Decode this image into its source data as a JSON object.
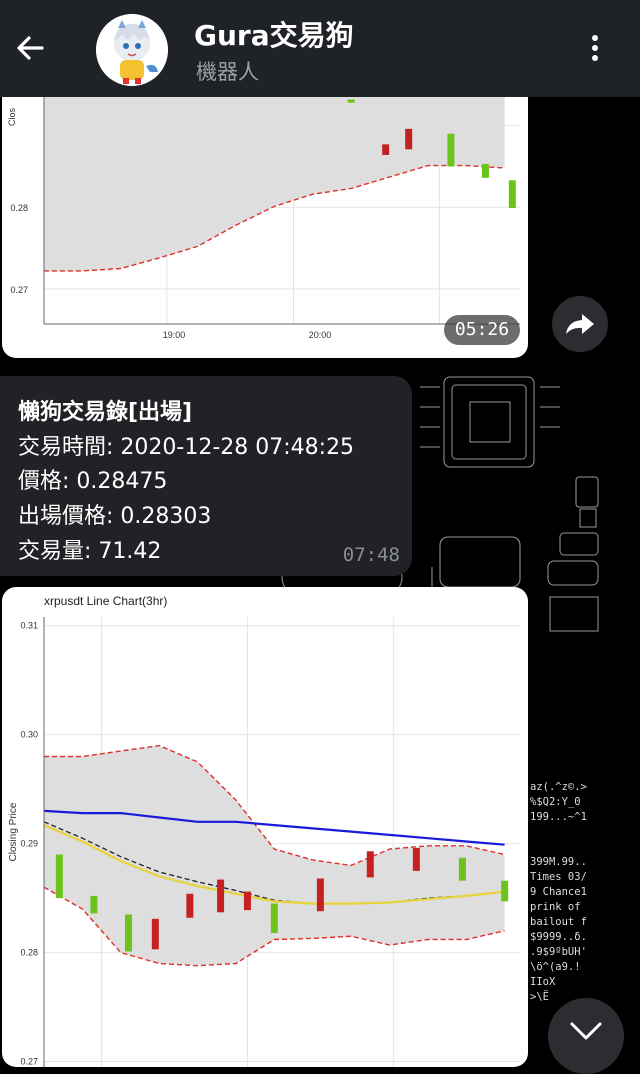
{
  "header": {
    "title": "Gura交易狗",
    "subtitle": "機器人"
  },
  "top_chart": {
    "timestamp": "05:26",
    "chart_data": {
      "type": "line",
      "y_ticks": [
        "0.28",
        "0.27"
      ],
      "x_ticks": [
        "19:00",
        "20:00"
      ],
      "ylabel": "Clos",
      "ylim": [
        0.2657,
        0.2935
      ],
      "x": [
        0,
        1,
        2,
        3,
        4,
        5,
        6,
        7,
        8,
        9,
        10,
        11,
        12
      ],
      "lower_band": [
        0.2722,
        0.2722,
        0.2725,
        0.2738,
        0.2752,
        0.2778,
        0.2801,
        0.2816,
        0.2823,
        0.2837,
        0.2851,
        0.2851,
        0.2848
      ],
      "candles": [
        {
          "x": 8.0,
          "open": 0.2932,
          "close": 0.2928,
          "color": "green"
        },
        {
          "x": 8.9,
          "open": 0.2877,
          "close": 0.2864,
          "color": "red"
        },
        {
          "x": 9.5,
          "open": 0.2896,
          "close": 0.2871,
          "color": "red"
        },
        {
          "x": 10.6,
          "open": 0.289,
          "close": 0.285,
          "color": "green"
        },
        {
          "x": 11.5,
          "open": 0.2853,
          "close": 0.2836,
          "color": "green"
        },
        {
          "x": 12.2,
          "open": 0.2833,
          "close": 0.2799,
          "color": "green"
        }
      ]
    }
  },
  "trade_message": {
    "title": "懶狗交易錄[出場]",
    "trade_time": "交易時間: 2020-12-28 07:48:25",
    "price": "價格: 0.28475",
    "exit_price": "出場價格: 0.28303",
    "volume": "交易量: 71.42",
    "time": "07:48"
  },
  "bottom_chart": {
    "chart_data": {
      "type": "line",
      "title": "xrpusdt Line Chart(3hr)",
      "ylabel": "Closing Price",
      "ylim": [
        0.2695,
        0.3108
      ],
      "y_ticks": [
        "0.31",
        "0.30",
        "0.29",
        "0.28",
        "0.27"
      ],
      "x": [
        0,
        1,
        2,
        3,
        4,
        5,
        6,
        7,
        8,
        9,
        10,
        11,
        12
      ],
      "upper_band": [
        0.298,
        0.298,
        0.2985,
        0.299,
        0.2975,
        0.294,
        0.2895,
        0.2885,
        0.288,
        0.2895,
        0.2898,
        0.2898,
        0.289
      ],
      "lower_band": [
        0.286,
        0.284,
        0.28,
        0.279,
        0.2788,
        0.279,
        0.2812,
        0.2813,
        0.2815,
        0.2807,
        0.2812,
        0.2812,
        0.282
      ],
      "series": [
        {
          "color": "#1a1adb",
          "values": [
            0.293,
            0.2928,
            0.2928,
            0.2924,
            0.292,
            0.292,
            0.2917,
            0.2914,
            0.2911,
            0.2908,
            0.2905,
            0.2902,
            0.2899
          ]
        },
        {
          "color": "#222222",
          "dash": true,
          "values": [
            0.292,
            0.2905,
            0.2888,
            0.2874,
            0.2865,
            0.2857,
            0.2848,
            0.2845,
            0.2845,
            0.2846,
            0.285,
            0.2852,
            0.2856
          ]
        },
        {
          "color": "#e8d23a",
          "values": [
            0.2917,
            0.2902,
            0.2884,
            0.287,
            0.2861,
            0.2854,
            0.2847,
            0.2845,
            0.2845,
            0.2846,
            0.2849,
            0.2852,
            0.2856
          ]
        }
      ],
      "candles": [
        {
          "x": 0.4,
          "open": 0.289,
          "close": 0.285,
          "color": "green"
        },
        {
          "x": 1.3,
          "open": 0.2852,
          "close": 0.2836,
          "color": "green"
        },
        {
          "x": 2.2,
          "open": 0.2835,
          "close": 0.2801,
          "color": "green"
        },
        {
          "x": 2.9,
          "open": 0.2831,
          "close": 0.2803,
          "color": "red"
        },
        {
          "x": 3.8,
          "open": 0.2854,
          "close": 0.2832,
          "color": "red"
        },
        {
          "x": 4.6,
          "open": 0.2867,
          "close": 0.2837,
          "color": "red"
        },
        {
          "x": 5.3,
          "open": 0.2856,
          "close": 0.2839,
          "color": "red"
        },
        {
          "x": 6.0,
          "open": 0.2845,
          "close": 0.2818,
          "color": "green"
        },
        {
          "x": 7.2,
          "open": 0.2868,
          "close": 0.2838,
          "color": "red"
        },
        {
          "x": 8.5,
          "open": 0.2893,
          "close": 0.2869,
          "color": "red"
        },
        {
          "x": 9.7,
          "open": 0.2896,
          "close": 0.2875,
          "color": "red"
        },
        {
          "x": 10.9,
          "open": 0.2887,
          "close": 0.2866,
          "color": "green"
        },
        {
          "x": 12.0,
          "open": 0.2866,
          "close": 0.2847,
          "color": "green"
        }
      ]
    }
  },
  "terminal_text": "az(.^z©.>\n%$Q2:Y_0\n199...~^1\n\n\n399M.99..\nTimes 03/\n9 Chance1\nprink of\nbailout f\n$9999..δ.\n.9$9ºbUH'\n\\ö^(a9.!\nIIoX\n>\\Ë\n"
}
